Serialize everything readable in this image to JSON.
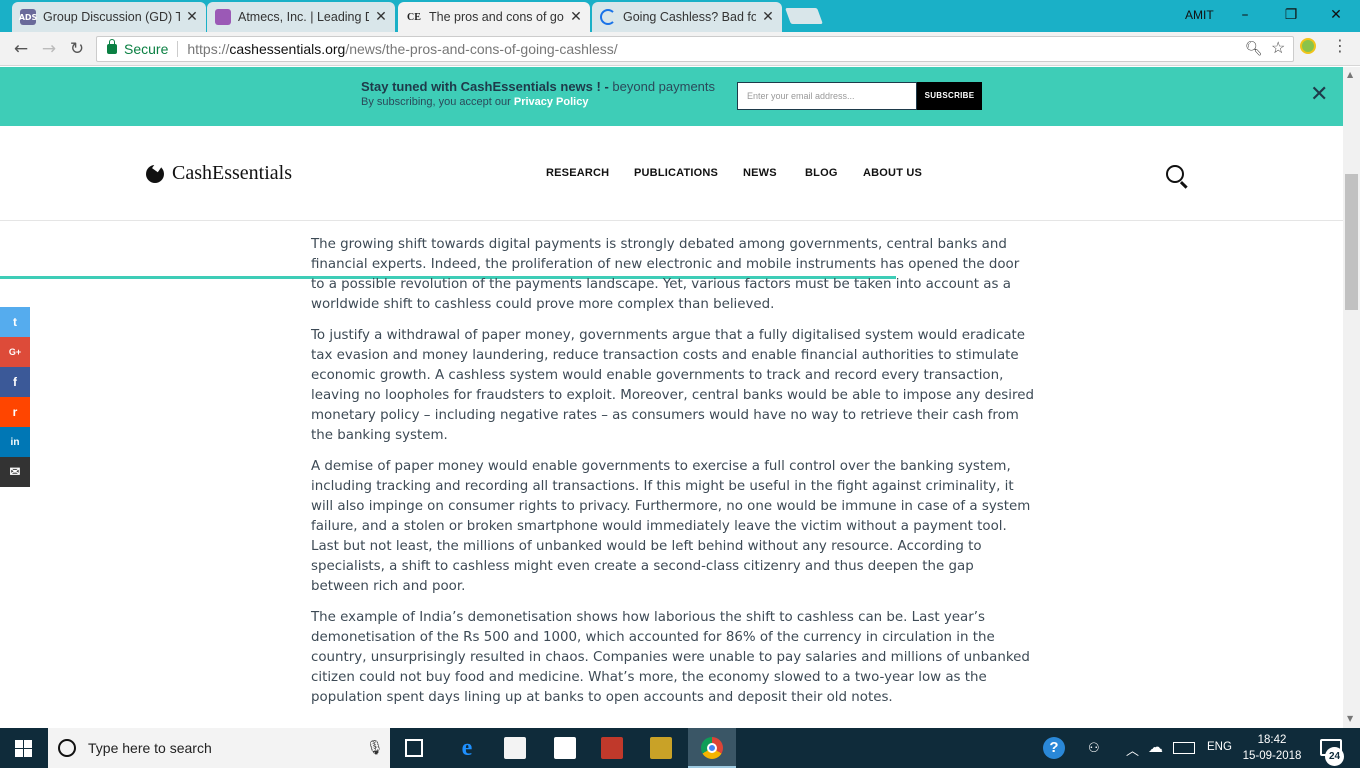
{
  "browser": {
    "tabs": [
      {
        "title": "Group Discussion (GD) To",
        "favicon": "ads-favicon",
        "color": "#6a6a9a"
      },
      {
        "title": "Atmecs, Inc. | Leading Dig",
        "favicon": "atmecs-favicon",
        "color": "#9b59b6"
      },
      {
        "title": "The pros and cons of goi",
        "favicon": "ce-favicon",
        "favicon_text": "CE",
        "color": "#222222",
        "active": true
      },
      {
        "title": "Going Cashless? Bad for T",
        "favicon": "loading-icon",
        "color": "#1a73e8"
      }
    ],
    "user": "AMIT",
    "window_controls": {
      "minimize": "–",
      "restore": "❐",
      "close": "✕"
    },
    "nav": {
      "back": "←",
      "forward": "→",
      "reload": "↻"
    },
    "address": {
      "secure_label": "Secure",
      "url_scheme": "https://",
      "url_host": "cashessentials.org",
      "url_path": "/news/the-pros-and-cons-of-going-cashless/"
    }
  },
  "banner": {
    "title_bold": "Stay tuned with CashEssentials news ! -",
    "title_light": " beyond payments",
    "sub_text": "By subscribing, you accept our ",
    "sub_link": "Privacy Policy",
    "email_placeholder": "Enter your email address...",
    "subscribe_label": "SUBSCRIBE",
    "close": "✕",
    "accent": "#3ecdb7"
  },
  "site": {
    "logo_text": "CashEssentials",
    "nav": [
      "RESEARCH",
      "PUBLICATIONS",
      "NEWS",
      "BLOG",
      "ABOUT US"
    ],
    "read_progress": 0.667
  },
  "share": [
    {
      "name": "twitter",
      "glyph": "t",
      "color": "#55acee"
    },
    {
      "name": "google-plus",
      "glyph": "G+",
      "color": "#dd4b39"
    },
    {
      "name": "facebook",
      "glyph": "f",
      "color": "#3b5998"
    },
    {
      "name": "reddit",
      "glyph": "r",
      "color": "#ff4500"
    },
    {
      "name": "linkedin",
      "glyph": "in",
      "color": "#0077b5"
    },
    {
      "name": "email",
      "glyph": "✉",
      "color": "#333333"
    }
  ],
  "article": {
    "paragraphs": [
      "The growing shift towards digital payments is strongly debated among governments, central banks and financial experts. Indeed, the proliferation of new electronic and mobile instruments has opened the door to a possible revolution of the payments landscape. Yet, various factors must be taken into account as a worldwide shift to cashless could prove more complex than believed.",
      "To justify a withdrawal of paper money, governments argue that a fully digitalised system would eradicate tax evasion and money laundering, reduce transaction costs and enable financial authorities to stimulate economic growth. A cashless system would enable governments to track and record every transaction, leaving no loopholes for fraudsters to exploit. Moreover, central banks would be able to impose any desired monetary policy – including negative rates – as consumers would have no way to retrieve their cash from the banking system.",
      "A demise of paper money would enable governments to exercise a full control over the banking system, including tracking and recording all transactions. If this might be useful in the fight against criminality, it will also impinge on consumer rights to privacy. Furthermore, no one would be immune in case of a system failure, and a stolen or broken smartphone would immediately leave the victim without a payment tool. Last but not least, the millions of unbanked would be left behind without any resource. According to specialists, a shift to cashless might even create a second-class citizenry and thus deepen the gap between rich and poor.",
      "The example of India’s demonetisation shows how laborious the shift to cashless can be. Last year’s demonetisation of the Rs 500 and 1000, which accounted for 86% of the currency in circulation in the country, unsurprisingly resulted in chaos. Companies were unable to pay salaries and millions of unbanked citizen could not buy food and medicine. What’s more, the economy slowed to a two-year low as the population spent days lining up at banks to open accounts and deposit their old notes."
    ]
  },
  "taskbar": {
    "search_placeholder": "Type here to search",
    "language": "ENG",
    "time": "18:42",
    "date": "15-09-2018",
    "notifications": "24"
  }
}
